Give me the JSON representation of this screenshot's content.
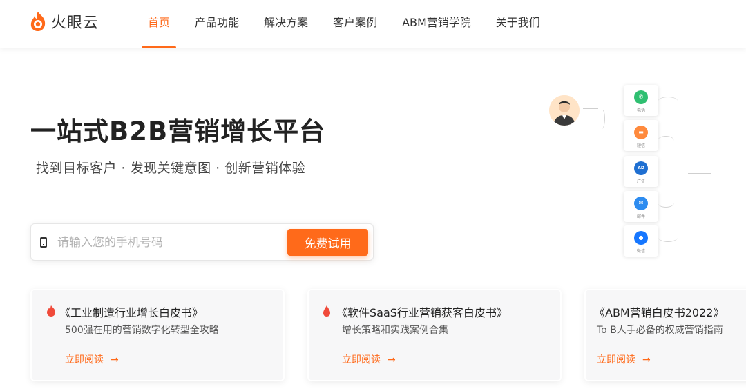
{
  "brand": {
    "name": "火眼云",
    "accent": "#ff6a1a"
  },
  "nav": {
    "items": [
      {
        "label": "首页",
        "active": true
      },
      {
        "label": "产品功能",
        "active": false
      },
      {
        "label": "解决方案",
        "active": false
      },
      {
        "label": "客户案例",
        "active": false
      },
      {
        "label": "ABM营销学院",
        "active": false
      },
      {
        "label": "关于我们",
        "active": false
      }
    ]
  },
  "hero": {
    "title": "一站式B2B营销增长平台",
    "subtitle": "找到目标客户 · 发现关键意图 · 创新营销体验"
  },
  "signup": {
    "placeholder": "请输入您的手机号码",
    "value": "",
    "button_label": "免费试用",
    "icon": "phone-icon"
  },
  "channels": [
    {
      "label": "电话",
      "icon": "phone-icon",
      "color": "#2fbf71"
    },
    {
      "label": "短信",
      "icon": "message-icon",
      "color": "#ff8a3d"
    },
    {
      "label": "广告",
      "icon": "ad-icon",
      "color": "#1f6fd1",
      "glyph": "AD"
    },
    {
      "label": "邮件",
      "icon": "mail-icon",
      "color": "#2d8cf0"
    },
    {
      "label": "微信",
      "icon": "wechat-icon",
      "color": "#1677ff"
    }
  ],
  "cards": [
    {
      "title": "《工业制造行业增长白皮书》",
      "desc": "500强在用的营销数字化转型全攻略",
      "link": "立即阅读",
      "arrow": "→",
      "icon": "flame-icon"
    },
    {
      "title": "《软件SaaS行业营销获客白皮书》",
      "desc": "增长策略和实践案例合集",
      "link": "立即阅读",
      "arrow": "→",
      "icon": "flame-icon"
    },
    {
      "title": "《ABM营销白皮书2022》",
      "desc": "To B人手必备的权威营销指南",
      "link": "立即阅读",
      "arrow": "→",
      "icon": ""
    }
  ]
}
